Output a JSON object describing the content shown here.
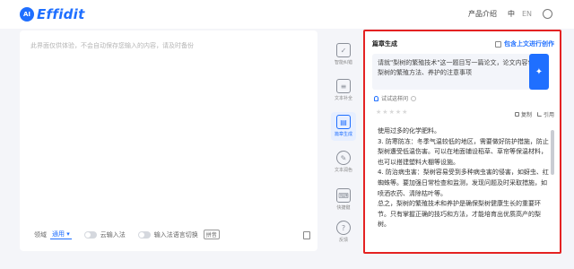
{
  "header": {
    "logo_badge": "AI",
    "logo_text": "Effidit",
    "nav_product": "产品介绍",
    "lang_zh": "中",
    "lang_en": "EN"
  },
  "editor": {
    "placeholder": "此界面仅供体验，不会自动保存您输入的内容，请及时备份",
    "domain_label": "领域",
    "domain_value": "通用",
    "cloud_input_label": "云输入法",
    "switch_label": "输入法语言切换",
    "switch_badge": "拼音"
  },
  "sidebar": {
    "items": [
      {
        "label": "智能纠错",
        "icon": "text-correct-icon"
      },
      {
        "label": "文本补全",
        "icon": "text-complete-icon"
      },
      {
        "label": "篇章生成",
        "icon": "article-generate-icon"
      },
      {
        "label": "文本润色",
        "icon": "text-polish-icon"
      },
      {
        "label": "快捷键",
        "icon": "keyboard-icon"
      },
      {
        "label": "反馈",
        "icon": "feedback-icon"
      }
    ]
  },
  "panel": {
    "title": "篇章生成",
    "context_checkbox_label": "包含上文进行创作",
    "prompt": "请就\"梨树的繁殖技术\"这一题目写一篇论文，论文内容包括梨树的繁殖方法、养护的注意事项",
    "try_label": "试试这样问",
    "copy_label": "复制",
    "quote_label": "引用",
    "stars_count": 5,
    "result_lines": [
      "使用过多的化学肥料。",
      "3. 防寒防冻：冬季气温较低的地区，需要做好防护措施，防止梨树遭受低温伤害。可以在地面铺设稻草、草帘等保温材料，也可以搭建塑料大棚等设施。",
      "4. 防治病虫害：梨树容易受到多种病虫害的侵害，如蚜虫、红蜘蛛等。要加强日常检查和监测，发现问题及时采取措施，如喷洒农药、清除枯叶等。",
      "总之，梨树的繁殖技术和养护是确保梨树健康生长的重要环节。只有掌握正确的技巧和方法，才能培育出优质高产的梨树。"
    ]
  },
  "colors": {
    "accent": "#1f6fff",
    "highlight_border": "#e42222"
  }
}
